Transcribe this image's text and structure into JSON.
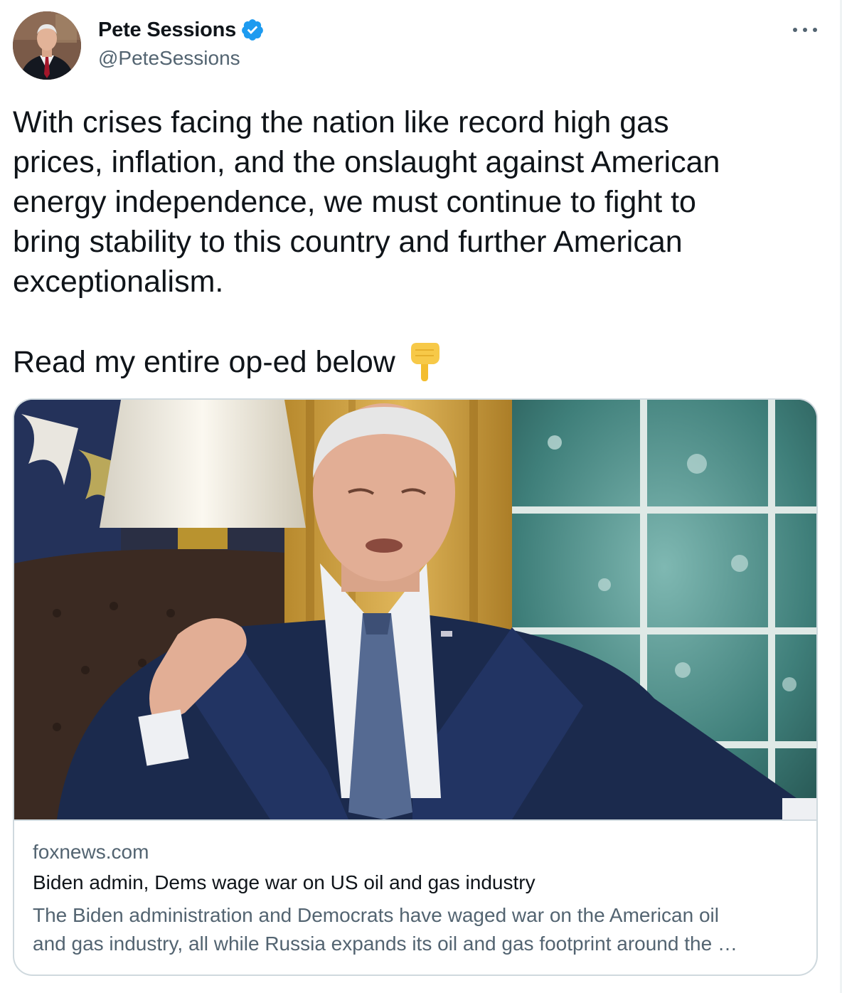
{
  "author": {
    "display_name": "Pete Sessions",
    "handle": "@PeteSessions",
    "verified": true,
    "avatar_icon": "profile-photo"
  },
  "tweet": {
    "text": "With crises facing the nation like record high gas\nprices, inflation, and the onslaught against American\nenergy independence, we must continue to fight to\nbring stability to this country and further American\nexceptionalism.",
    "cta_text": "Read my entire op-ed below",
    "cta_emoji": "backhand-index-pointing-down"
  },
  "more_menu_icon": "ellipsis-icon",
  "link_card": {
    "domain": "foxnews.com",
    "title": "Biden admin, Dems wage war on US oil and gas industry",
    "description": "The Biden administration and Democrats have waged war on the American oil\nand gas industry, all while Russia expands its oil and gas footprint around the …"
  },
  "colors": {
    "text_primary": "#0f1419",
    "text_secondary": "#536471",
    "verified_blue": "#1d9bf0",
    "border": "#cfd9de"
  }
}
